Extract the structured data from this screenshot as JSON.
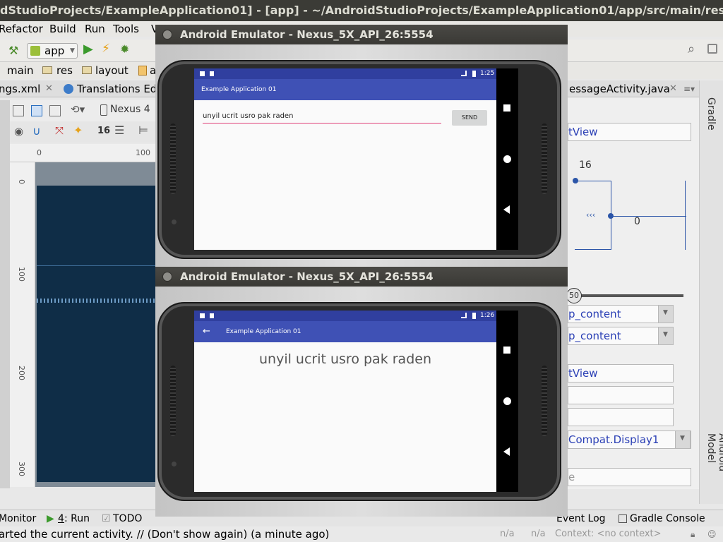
{
  "ide": {
    "title_fragment": "dStudioProjects/ExampleApplication01] - [app] - ~/AndroidStudioProjects/ExampleApplication01/app/src/main/res/layout/activity_dis",
    "menu": [
      "Refactor",
      "Build",
      "Run",
      "Tools",
      "V"
    ],
    "run_config": "app",
    "breadcrumbs": [
      "main",
      "res",
      "layout",
      "a"
    ],
    "tabs": [
      "ngs.xml",
      "Translations Ed",
      "essageActivity.java"
    ],
    "device": "Nexus 4",
    "text_size": "16",
    "ruler_top": [
      "0",
      "100"
    ],
    "ruler_left": [
      "0",
      "100",
      "200",
      "300"
    ],
    "right_panel": {
      "component": "tView",
      "margin_top": "16",
      "margin_start": "0",
      "slider_value": "50",
      "width": "p_content",
      "height": "p_content",
      "text": "tView",
      "text_appearance": "Compat.Display1",
      "last_field": "e"
    },
    "side_tabs": [
      "Gradle",
      "Android Model"
    ],
    "bottom_tools": {
      "monitor": "Monitor",
      "run_num": "4",
      "run": ": Run",
      "todo": "TODO",
      "event_log": "Event Log",
      "gradle_console": "Gradle Console"
    },
    "status": {
      "message": "arted the current activity. // (Don't show again) (a minute ago)",
      "na1": "n/a",
      "na2": "n/a",
      "context": "Context: <no context>"
    }
  },
  "emulators": [
    {
      "title": "Android Emulator - Nexus_5X_API_26:5554",
      "time": "1:25",
      "app_title": "Example Application 01",
      "input_value": "unyil ucrit usro pak raden",
      "send_label": "SEND"
    },
    {
      "title": "Android Emulator - Nexus_5X_API_26:5554",
      "time": "1:26",
      "app_title": "Example Application 01",
      "message": "unyil ucrit usro pak raden"
    }
  ],
  "colors": {
    "primary": "#3f51b5",
    "primary_dark": "#303f9f",
    "accent": "#ff4081",
    "ide_link": "#2a3fb5"
  }
}
